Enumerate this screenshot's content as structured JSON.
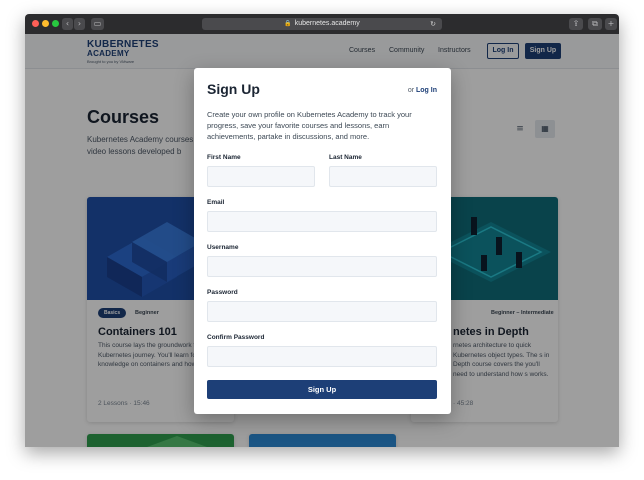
{
  "browser": {
    "url": "kubernetes.academy",
    "lock_icon": "lock-icon",
    "reload_icon": "reload-icon",
    "traffic_colors": [
      "#fe5f57",
      "#febc2e",
      "#28c840"
    ]
  },
  "nav": {
    "logo_line1": "KUBERNETES",
    "logo_line2": "ACADEMY",
    "logo_tagline": "Brought to you by VMware",
    "links": [
      "Courses",
      "Community",
      "Instructors"
    ],
    "login_label": "Log In",
    "signup_label": "Sign Up"
  },
  "main": {
    "title": "Courses",
    "description": "Kubernetes Academy courses consist of bite-size video lessons developed b",
    "courses": [
      {
        "badge": "Basics",
        "level": "Beginner",
        "title": "Containers 101",
        "description": "This course lays the groundwork for your Kubernetes journey. You'll learn foundational knowledge on containers and how they work.",
        "meta": "2 Lessons  ·  15:46"
      },
      {
        "badge": "",
        "level": "Beginner – Intermediate",
        "title": "netes in Depth",
        "description": "rnetes architecture to quick Kubernetes object types. The s in Depth course covers the you'll need to understand how s works.",
        "meta": "·  45:28"
      }
    ]
  },
  "modal": {
    "title": "Sign Up",
    "or_text": "or",
    "login_link": "Log In",
    "intro": "Create your own profile on Kubernetes Academy to track your progress, save your favorite courses and lessons, earn achievements, partake in discussions, and more.",
    "fields": {
      "first_name": {
        "label": "First Name",
        "value": ""
      },
      "last_name": {
        "label": "Last Name",
        "value": ""
      },
      "email": {
        "label": "Email",
        "value": ""
      },
      "username": {
        "label": "Username",
        "value": ""
      },
      "password": {
        "label": "Password",
        "value": ""
      },
      "confirm_password": {
        "label": "Confirm Password",
        "value": ""
      }
    },
    "submit_label": "Sign Up"
  },
  "colors": {
    "brand": "#1d3f77",
    "overlay": "rgba(0,0,0,0.38)"
  }
}
